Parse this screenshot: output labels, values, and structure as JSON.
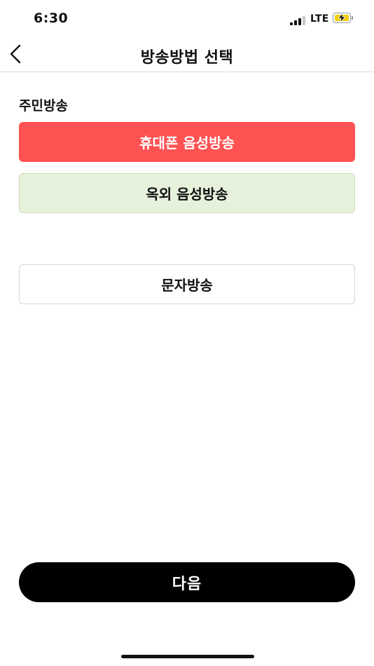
{
  "status_bar": {
    "time": "6:30",
    "network": "LTE",
    "icons": [
      "signal-icon",
      "battery-charging-icon"
    ]
  },
  "nav": {
    "title": "방송방법 선택",
    "back_icon": "chevron-left-icon"
  },
  "section": {
    "label": "주민방송"
  },
  "options": [
    {
      "label": "휴대폰 음성방송",
      "selected": true,
      "color": "#ff5252"
    },
    {
      "label": "옥외 음성방송",
      "selected": false,
      "color": "#e6f1dc"
    },
    {
      "label": "문자방송",
      "selected": false,
      "color": "#ffffff"
    }
  ],
  "actions": {
    "next_label": "다음"
  },
  "colors": {
    "accent": "#ff5252",
    "primary_button": "#000000"
  }
}
